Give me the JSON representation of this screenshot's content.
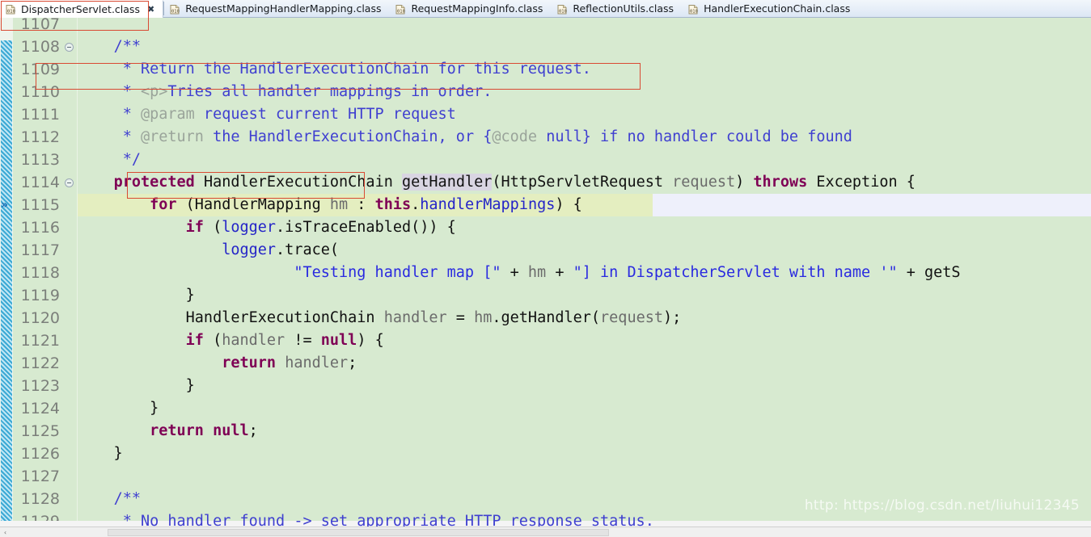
{
  "window": {
    "kind": "java-class-file-editor"
  },
  "tabs": [
    {
      "label": "DispatcherServlet.class",
      "icon": "class-file-icon",
      "active": true,
      "closable": true,
      "close_glyph": "✖"
    },
    {
      "label": "RequestMappingHandlerMapping.class",
      "icon": "class-file-icon",
      "active": false,
      "closable": false
    },
    {
      "label": "RequestMappingInfo.class",
      "icon": "class-file-icon",
      "active": false,
      "closable": false
    },
    {
      "label": "ReflectionUtils.class",
      "icon": "class-file-icon",
      "active": false,
      "closable": false
    },
    {
      "label": "HandlerExecutionChain.class",
      "icon": "class-file-icon",
      "active": false,
      "closable": false
    }
  ],
  "editor": {
    "first_line_number": 1107,
    "current_line_number": 1115,
    "fold_marker_lines": [
      1108,
      1114
    ],
    "execution_marker_line": 1115,
    "line_height": 28,
    "colors": {
      "background": "#d7ead0",
      "current_line": "#e4eec0",
      "current_line_tail": "#eef0fb",
      "line_number": "#7b7f7a",
      "keyword": "#7f0055",
      "comment": "#3f3fd0",
      "comment_tag": "#9aa49a",
      "string": "#2a2ae0",
      "field": "#2424c8",
      "local_var": "#6b6b6b",
      "annotation_box": "#d94a33",
      "changed_bar": "#3ba9d4"
    },
    "lines": [
      {
        "n": 1107,
        "tokens": []
      },
      {
        "n": 1108,
        "tokens": [
          {
            "t": "    ",
            "c": "plain"
          },
          {
            "t": "/**",
            "c": "cmt"
          }
        ]
      },
      {
        "n": 1109,
        "tokens": [
          {
            "t": "     * ",
            "c": "cmt"
          },
          {
            "t": "Return the HandlerExecutionChain for this request.",
            "c": "cmt"
          }
        ]
      },
      {
        "n": 1110,
        "tokens": [
          {
            "t": "     * ",
            "c": "cmt"
          },
          {
            "t": "<p>",
            "c": "cmt-tag"
          },
          {
            "t": "Tries all handler mappings in order.",
            "c": "cmt"
          }
        ]
      },
      {
        "n": 1111,
        "tokens": [
          {
            "t": "     * ",
            "c": "cmt"
          },
          {
            "t": "@param",
            "c": "cmt-tag"
          },
          {
            "t": " request current HTTP request",
            "c": "cmt"
          }
        ]
      },
      {
        "n": 1112,
        "tokens": [
          {
            "t": "     * ",
            "c": "cmt"
          },
          {
            "t": "@return",
            "c": "cmt-tag"
          },
          {
            "t": " the HandlerExecutionChain, or {",
            "c": "cmt"
          },
          {
            "t": "@code",
            "c": "cmt-tag"
          },
          {
            "t": " null} if no handler could be found",
            "c": "cmt"
          }
        ]
      },
      {
        "n": 1113,
        "tokens": [
          {
            "t": "     */",
            "c": "cmt"
          }
        ]
      },
      {
        "n": 1114,
        "tokens": [
          {
            "t": "    ",
            "c": "plain"
          },
          {
            "t": "protected",
            "c": "kw"
          },
          {
            "t": " HandlerExecutionChain ",
            "c": "plain"
          },
          {
            "t": "getHandler",
            "c": "plain mhl"
          },
          {
            "t": "(HttpServletRequest ",
            "c": "plain"
          },
          {
            "t": "request",
            "c": "loc"
          },
          {
            "t": ") ",
            "c": "plain"
          },
          {
            "t": "throws",
            "c": "kw"
          },
          {
            "t": " Exception {",
            "c": "plain"
          }
        ]
      },
      {
        "n": 1115,
        "tokens": [
          {
            "t": "        ",
            "c": "plain"
          },
          {
            "t": "for",
            "c": "kw"
          },
          {
            "t": " (HandlerMapping ",
            "c": "plain"
          },
          {
            "t": "hm",
            "c": "loc"
          },
          {
            "t": " : ",
            "c": "plain"
          },
          {
            "t": "this",
            "c": "kw"
          },
          {
            "t": ".",
            "c": "plain"
          },
          {
            "t": "handlerMappings",
            "c": "fld"
          },
          {
            "t": ") {",
            "c": "plain"
          }
        ]
      },
      {
        "n": 1116,
        "tokens": [
          {
            "t": "            ",
            "c": "plain"
          },
          {
            "t": "if",
            "c": "kw"
          },
          {
            "t": " (",
            "c": "plain"
          },
          {
            "t": "logger",
            "c": "fld"
          },
          {
            "t": ".isTraceEnabled()) {",
            "c": "plain"
          }
        ]
      },
      {
        "n": 1117,
        "tokens": [
          {
            "t": "                ",
            "c": "plain"
          },
          {
            "t": "logger",
            "c": "fld"
          },
          {
            "t": ".trace(",
            "c": "plain"
          }
        ]
      },
      {
        "n": 1118,
        "tokens": [
          {
            "t": "                        ",
            "c": "plain"
          },
          {
            "t": "\"Testing handler map [\"",
            "c": "str"
          },
          {
            "t": " + ",
            "c": "plain"
          },
          {
            "t": "hm",
            "c": "loc"
          },
          {
            "t": " + ",
            "c": "plain"
          },
          {
            "t": "\"] in DispatcherServlet with name '\"",
            "c": "str"
          },
          {
            "t": " + getS",
            "c": "plain"
          }
        ]
      },
      {
        "n": 1119,
        "tokens": [
          {
            "t": "            }",
            "c": "plain"
          }
        ]
      },
      {
        "n": 1120,
        "tokens": [
          {
            "t": "            HandlerExecutionChain ",
            "c": "plain"
          },
          {
            "t": "handler",
            "c": "loc"
          },
          {
            "t": " = ",
            "c": "plain"
          },
          {
            "t": "hm",
            "c": "loc"
          },
          {
            "t": ".getHandler(",
            "c": "plain"
          },
          {
            "t": "request",
            "c": "loc"
          },
          {
            "t": ");",
            "c": "plain"
          }
        ]
      },
      {
        "n": 1121,
        "tokens": [
          {
            "t": "            ",
            "c": "plain"
          },
          {
            "t": "if",
            "c": "kw"
          },
          {
            "t": " (",
            "c": "plain"
          },
          {
            "t": "handler",
            "c": "loc"
          },
          {
            "t": " != ",
            "c": "plain"
          },
          {
            "t": "null",
            "c": "kw"
          },
          {
            "t": ") {",
            "c": "plain"
          }
        ]
      },
      {
        "n": 1122,
        "tokens": [
          {
            "t": "                ",
            "c": "plain"
          },
          {
            "t": "return",
            "c": "kw"
          },
          {
            "t": " ",
            "c": "plain"
          },
          {
            "t": "handler",
            "c": "loc"
          },
          {
            "t": ";",
            "c": "plain"
          }
        ]
      },
      {
        "n": 1123,
        "tokens": [
          {
            "t": "            }",
            "c": "plain"
          }
        ]
      },
      {
        "n": 1124,
        "tokens": [
          {
            "t": "        }",
            "c": "plain"
          }
        ]
      },
      {
        "n": 1125,
        "tokens": [
          {
            "t": "        ",
            "c": "plain"
          },
          {
            "t": "return",
            "c": "kw"
          },
          {
            "t": " ",
            "c": "plain"
          },
          {
            "t": "null",
            "c": "kw"
          },
          {
            "t": ";",
            "c": "plain"
          }
        ]
      },
      {
        "n": 1126,
        "tokens": [
          {
            "t": "    }",
            "c": "plain"
          }
        ]
      },
      {
        "n": 1127,
        "tokens": []
      },
      {
        "n": 1128,
        "tokens": [
          {
            "t": "    ",
            "c": "plain"
          },
          {
            "t": "/**",
            "c": "cmt"
          }
        ]
      },
      {
        "n": 1129,
        "tokens": [
          {
            "t": "     * ",
            "c": "cmt"
          },
          {
            "t": "No handler found -> set appropriate HTTP response status.",
            "c": "cmt"
          }
        ]
      }
    ]
  },
  "annotations": [
    {
      "name": "tab-highlight-box",
      "target": "DispatcherServlet.class tab"
    },
    {
      "name": "javadoc-summary-box",
      "target": "Return the HandlerExecutionChain for this request."
    },
    {
      "name": "return-type-box",
      "target": "HandlerExecutionChain"
    }
  ],
  "watermark": {
    "text": "http: https://blog.csdn.net/liuhui12345"
  },
  "scrollbar": {
    "left_arrow": "‹",
    "right_arrow": "›"
  }
}
